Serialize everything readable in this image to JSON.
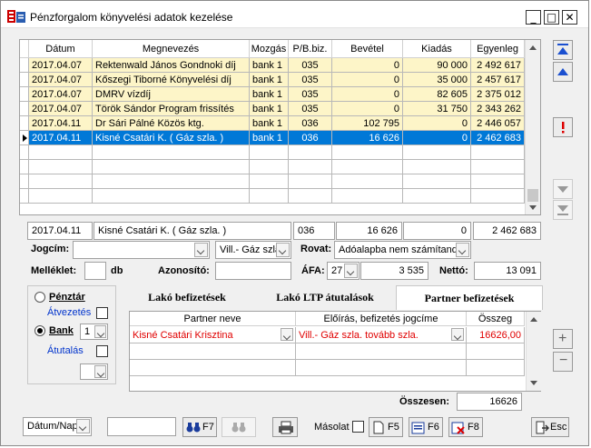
{
  "window": {
    "title": "Pénzforgalom könyvelési adatok kezelése",
    "minimize": "_",
    "maximize": "□",
    "close": "✕"
  },
  "grid": {
    "columns": [
      "Dátum",
      "Megnevezés",
      "Mozgás",
      "P/B.biz.",
      "Bevétel",
      "Kiadás",
      "Egyenleg"
    ],
    "rows": [
      [
        "2017.04.07",
        "Rektenwald János Gondnoki díj",
        "bank 1",
        "035",
        "0",
        "90 000",
        "2 492 617"
      ],
      [
        "2017.04.07",
        "Kőszegi Tiborné Könyvelési díj",
        "bank 1",
        "035",
        "0",
        "35 000",
        "2 457 617"
      ],
      [
        "2017.04.07",
        "DMRV  vízdíj",
        "bank 1",
        "035",
        "0",
        "82 605",
        "2 375 012"
      ],
      [
        "2017.04.07",
        "Török Sándor Program frissítés",
        "bank 1",
        "035",
        "0",
        "31 750",
        "2 343 262"
      ],
      [
        "2017.04.11",
        "Dr Sári Pálné Közös ktg.",
        "bank 1",
        "036",
        "102 795",
        "0",
        "2 446 057"
      ],
      [
        "2017.04.11",
        "Kisné Csatári K. ( Gáz szla. )",
        "bank 1",
        "036",
        "16 626",
        "0",
        "2 462 683"
      ]
    ]
  },
  "detail": {
    "date": "2017.04.11",
    "name": "Kisné Csatári K. ( Gáz szla. )",
    "doc": "036",
    "income": "16 626",
    "expense": "0",
    "balance": "2 462 683"
  },
  "form": {
    "jogcim_label": "Jogcím:",
    "jogcim_value": "",
    "vill_value": "Vill.- Gáz szla.",
    "rovat_label": "Rovat:",
    "rovat_value": "Adóalapba nem számítandó",
    "melleklet_label": "Melléklet:",
    "melleklet_value": "",
    "db_label": "db",
    "azonosito_label": "Azonosító:",
    "azonosito_value": "",
    "afa_label": "ÁFA:",
    "afa_rate": "27",
    "afa_value": "3 535",
    "netto_label": "Nettó:",
    "netto_value": "13 091"
  },
  "payment": {
    "penztar": "Pénztár",
    "atvezetes": "Átvezetés",
    "bank": "Bank",
    "bank_no": "1",
    "atutalas": "Átutalás"
  },
  "tabs": [
    "Lakó befizetések",
    "Lakó LTP átutalások",
    "Partner befizetések"
  ],
  "partner": {
    "columns": [
      "Partner neve",
      "Előírás, befizetés jogcíme",
      "Összeg"
    ],
    "row": {
      "name": "Kisné Csatári Krisztina",
      "jogcim": "Vill.- Gáz szla. tovább szla.",
      "amount": "16626,00"
    },
    "total_label": "Összesen:",
    "total": "16626"
  },
  "toolbar": {
    "sort": "Dátum/Nap",
    "search": "",
    "f7": "F7",
    "masolat": "Másolat",
    "f5": "F5",
    "f6": "F6",
    "f8": "F8",
    "esc": "Esc"
  },
  "colors": {
    "selection": "#0078d7",
    "row_highlight": "#fdf5c8",
    "red": "#e00000",
    "blue": "#0033cc"
  }
}
